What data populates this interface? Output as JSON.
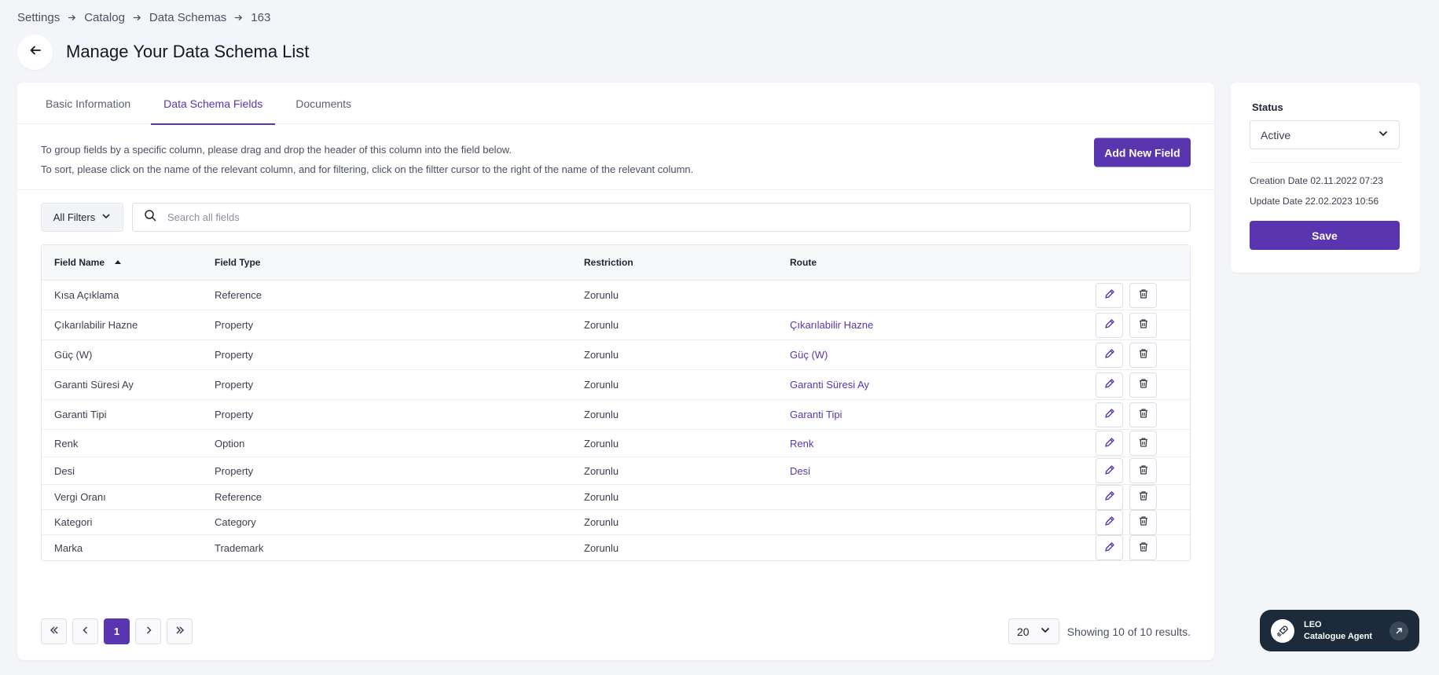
{
  "breadcrumb": [
    "Settings",
    "Catalog",
    "Data Schemas",
    "163"
  ],
  "page": {
    "title": "Manage Your Data Schema List"
  },
  "tabs": [
    {
      "label": "Basic Information",
      "active": false
    },
    {
      "label": "Data Schema Fields",
      "active": true
    },
    {
      "label": "Documents",
      "active": false
    }
  ],
  "info": {
    "line1": "To group fields by a specific column, please drag and drop the header of this column into the field below.",
    "line2": "To sort, please click on the name of the relevant column, and for filtering, click on the filtter cursor to the right of the name of the relevant column.",
    "add_button": "Add New Field"
  },
  "filters": {
    "all_filters_label": "All Filters",
    "search_placeholder": "Search all fields"
  },
  "table": {
    "headers": {
      "field_name": "Field Name",
      "field_type": "Field Type",
      "restriction": "Restriction",
      "route": "Route"
    },
    "rows": [
      {
        "field_name": "Kısa Açıklama",
        "field_type": "Reference",
        "restriction": "Zorunlu",
        "route": ""
      },
      {
        "field_name": "Çıkarılabilir Hazne",
        "field_type": "Property",
        "restriction": "Zorunlu",
        "route": "Çıkarılabilir Hazne"
      },
      {
        "field_name": "Güç (W)",
        "field_type": "Property",
        "restriction": "Zorunlu",
        "route": "Güç (W)"
      },
      {
        "field_name": "Garanti Süresi Ay",
        "field_type": "Property",
        "restriction": "Zorunlu",
        "route": "Garanti Süresi Ay"
      },
      {
        "field_name": "Garanti Tipi",
        "field_type": "Property",
        "restriction": "Zorunlu",
        "route": "Garanti Tipi"
      },
      {
        "field_name": "Renk",
        "field_type": "Option",
        "restriction": "Zorunlu",
        "route": "Renk"
      },
      {
        "field_name": "Desi",
        "field_type": "Property",
        "restriction": "Zorunlu",
        "route": "Desi"
      },
      {
        "field_name": "Vergi Oranı",
        "field_type": "Reference",
        "restriction": "Zorunlu",
        "route": ""
      },
      {
        "field_name": "Kategori",
        "field_type": "Category",
        "restriction": "Zorunlu",
        "route": ""
      },
      {
        "field_name": "Marka",
        "field_type": "Trademark",
        "restriction": "Zorunlu",
        "route": ""
      }
    ]
  },
  "pagination": {
    "current_page": "1",
    "page_size": "20",
    "showing": "Showing 10 of 10 results."
  },
  "side": {
    "status_label": "Status",
    "status_value": "Active",
    "creation_date": "Creation Date 02.11.2022 07:23",
    "update_date": "Update Date 22.02.2023 10:56",
    "save_label": "Save"
  },
  "agent": {
    "name": "LEO",
    "subtitle": "Catalogue Agent"
  },
  "colors": {
    "accent": "#5a35b0",
    "agent_bg": "#1d2a3a",
    "background": "#f4f5f8"
  }
}
